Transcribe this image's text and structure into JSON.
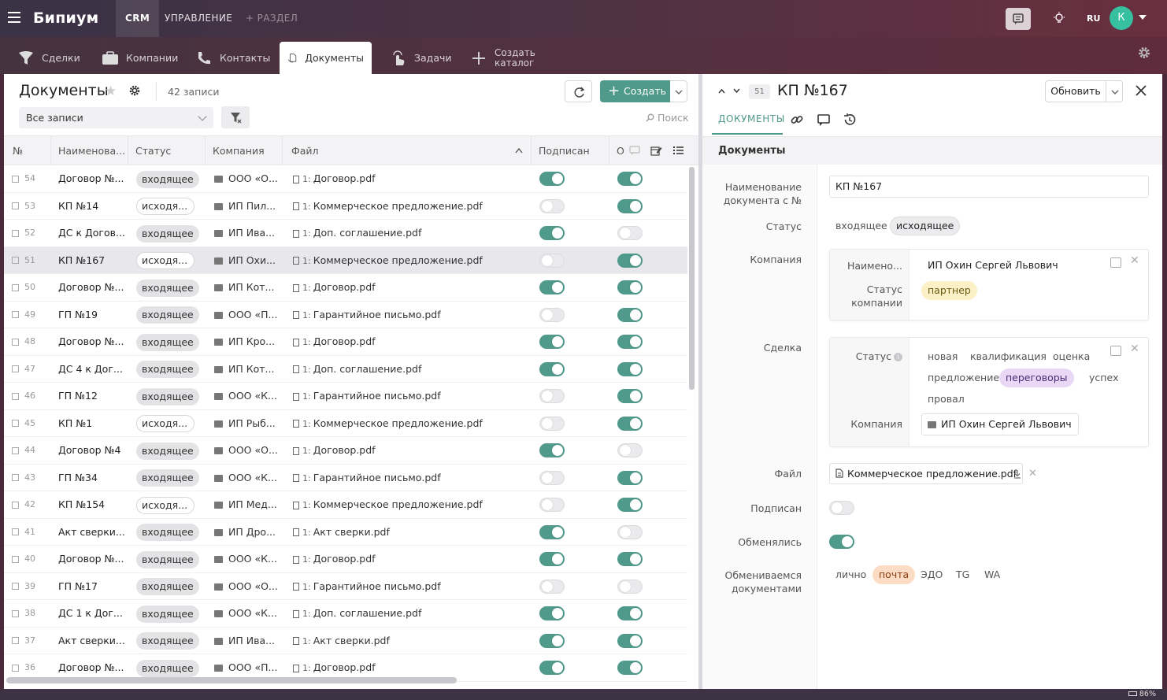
{
  "app": {
    "logo": "Бипиум",
    "top_tabs": [
      "CRM",
      "УПРАВЛЕНИЕ",
      "+ РАЗДЕЛ"
    ],
    "lang": "RU",
    "avatar_letter": "К",
    "zoom": "86%"
  },
  "nav": [
    {
      "label": "Сделки",
      "icon": "funnel-icon"
    },
    {
      "label": "Компании",
      "icon": "briefcase-icon"
    },
    {
      "label": "Контакты",
      "icon": "phone-icon"
    },
    {
      "label": "Документы",
      "icon": "document-icon",
      "active": true
    },
    {
      "label": "Задачи",
      "icon": "tap-icon"
    },
    {
      "label": "Создать каталог",
      "line1": "Создать",
      "line2": "каталог",
      "icon": "plus-icon"
    }
  ],
  "list": {
    "title": "Документы",
    "count": "42 записи",
    "create_label": "Создать",
    "filter_value": "Все записи",
    "search_placeholder": "Поиск",
    "columns": [
      "№",
      "Наименова...",
      "Статус",
      "Компания",
      "Файл",
      "Подписан",
      "О"
    ],
    "rows": [
      {
        "num": "54",
        "name": "Договор №...",
        "status": "входящее",
        "company": "ООО «О...",
        "file": "Договор.pdf",
        "signed": true,
        "exchanged": true
      },
      {
        "num": "53",
        "name": "КП №14",
        "status": "исходя...",
        "company": "ИП Пил...",
        "file": "Коммерческое предложение.pdf",
        "signed": false,
        "exchanged": true
      },
      {
        "num": "52",
        "name": "ДС к Догов...",
        "status": "входящее",
        "company": "ИП Ива...",
        "file": "Доп. соглашение.pdf",
        "signed": true,
        "exchanged": false
      },
      {
        "num": "51",
        "name": "КП №167",
        "status": "исходя...",
        "company": "ИП Охи...",
        "file": "Коммерческое предложение.pdf",
        "signed": false,
        "exchanged": true,
        "selected": true
      },
      {
        "num": "50",
        "name": "Договор №...",
        "status": "входящее",
        "company": "ИП Кот...",
        "file": "Договор.pdf",
        "signed": true,
        "exchanged": true
      },
      {
        "num": "49",
        "name": "ГП №19",
        "status": "входящее",
        "company": "ООО «П...",
        "file": "Гарантийное письмо.pdf",
        "signed": false,
        "exchanged": true
      },
      {
        "num": "48",
        "name": "Договор №...",
        "status": "входящее",
        "company": "ИП Кро...",
        "file": "Договор.pdf",
        "signed": true,
        "exchanged": true
      },
      {
        "num": "47",
        "name": "ДС 4 к Дог...",
        "status": "входящее",
        "company": "ИП Кот...",
        "file": "Доп. соглашение.pdf",
        "signed": true,
        "exchanged": true
      },
      {
        "num": "46",
        "name": "ГП №12",
        "status": "входящее",
        "company": "ООО «К...",
        "file": "Гарантийное письмо.pdf",
        "signed": false,
        "exchanged": true
      },
      {
        "num": "45",
        "name": "КП №1",
        "status": "исходя...",
        "company": "ИП Рыб...",
        "file": "Коммерческое предложение.pdf",
        "signed": false,
        "exchanged": true
      },
      {
        "num": "44",
        "name": "Договор №4",
        "status": "входящее",
        "company": "ООО «О...",
        "file": "Договор.pdf",
        "signed": true,
        "exchanged": false
      },
      {
        "num": "43",
        "name": "ГП №34",
        "status": "входящее",
        "company": "ООО «К...",
        "file": "Гарантийное письмо.pdf",
        "signed": false,
        "exchanged": true
      },
      {
        "num": "42",
        "name": "КП №154",
        "status": "исходя...",
        "company": "ИП Мед...",
        "file": "Коммерческое предложение.pdf",
        "signed": false,
        "exchanged": true
      },
      {
        "num": "41",
        "name": "Акт сверки...",
        "status": "входящее",
        "company": "ИП Дро...",
        "file": "Акт сверки.pdf",
        "signed": true,
        "exchanged": false
      },
      {
        "num": "40",
        "name": "Договор №...",
        "status": "входящее",
        "company": "ООО «К...",
        "file": "Договор.pdf",
        "signed": true,
        "exchanged": true
      },
      {
        "num": "39",
        "name": "ГП №17",
        "status": "входящее",
        "company": "ООО «О...",
        "file": "Гарантийное письмо.pdf",
        "signed": false,
        "exchanged": false
      },
      {
        "num": "38",
        "name": "ДС 1 к Дог...",
        "status": "входящее",
        "company": "ООО «К...",
        "file": "Доп. соглашение.pdf",
        "signed": true,
        "exchanged": true
      },
      {
        "num": "37",
        "name": "Акт сверки...",
        "status": "входящее",
        "company": "ИП Ива...",
        "file": "Акт сверки.pdf",
        "signed": true,
        "exchanged": true
      },
      {
        "num": "36",
        "name": "Договор №...",
        "status": "входящее",
        "company": "ООО «П...",
        "file": "Договор.pdf",
        "signed": true,
        "exchanged": true
      }
    ]
  },
  "detail": {
    "id": "51",
    "title": "КП №167",
    "update_label": "Обновить",
    "tab_label": "ДОКУМЕНТЫ",
    "section": "Документы",
    "labels": {
      "name": "Наименование документа с №",
      "status": "Статус",
      "company": "Компания",
      "deal": "Сделка",
      "file": "Файл",
      "signed": "Подписан",
      "exchanged": "Обменялись",
      "exchange_by": "Обмениваемся документами"
    },
    "name_value": "КП №167",
    "status_options": [
      "входящее",
      "исходящее"
    ],
    "status_selected": "исходящее",
    "company_card": {
      "label_name": "Наимено...",
      "name": "ИП Охин Сергей Львович",
      "label_status": "Статус компании",
      "status": "партнер"
    },
    "deal_card": {
      "label_status": "Статус",
      "stages": [
        "новая",
        "квалификация",
        "оценка",
        "предложение",
        "переговоры",
        "успех",
        "провал"
      ],
      "stage_selected": "переговоры",
      "label_company": "Компания",
      "company": "ИП Охин Сергей Львович"
    },
    "file_name": "Коммерческое предложение.pdf",
    "signed": false,
    "exchanged": true,
    "exchange_options": [
      "лично",
      "почта",
      "ЭДО",
      "TG",
      "WA"
    ],
    "exchange_selected": "почта"
  },
  "colors": {
    "accent": "#4f9a8b",
    "topbar": "#4d3244"
  }
}
